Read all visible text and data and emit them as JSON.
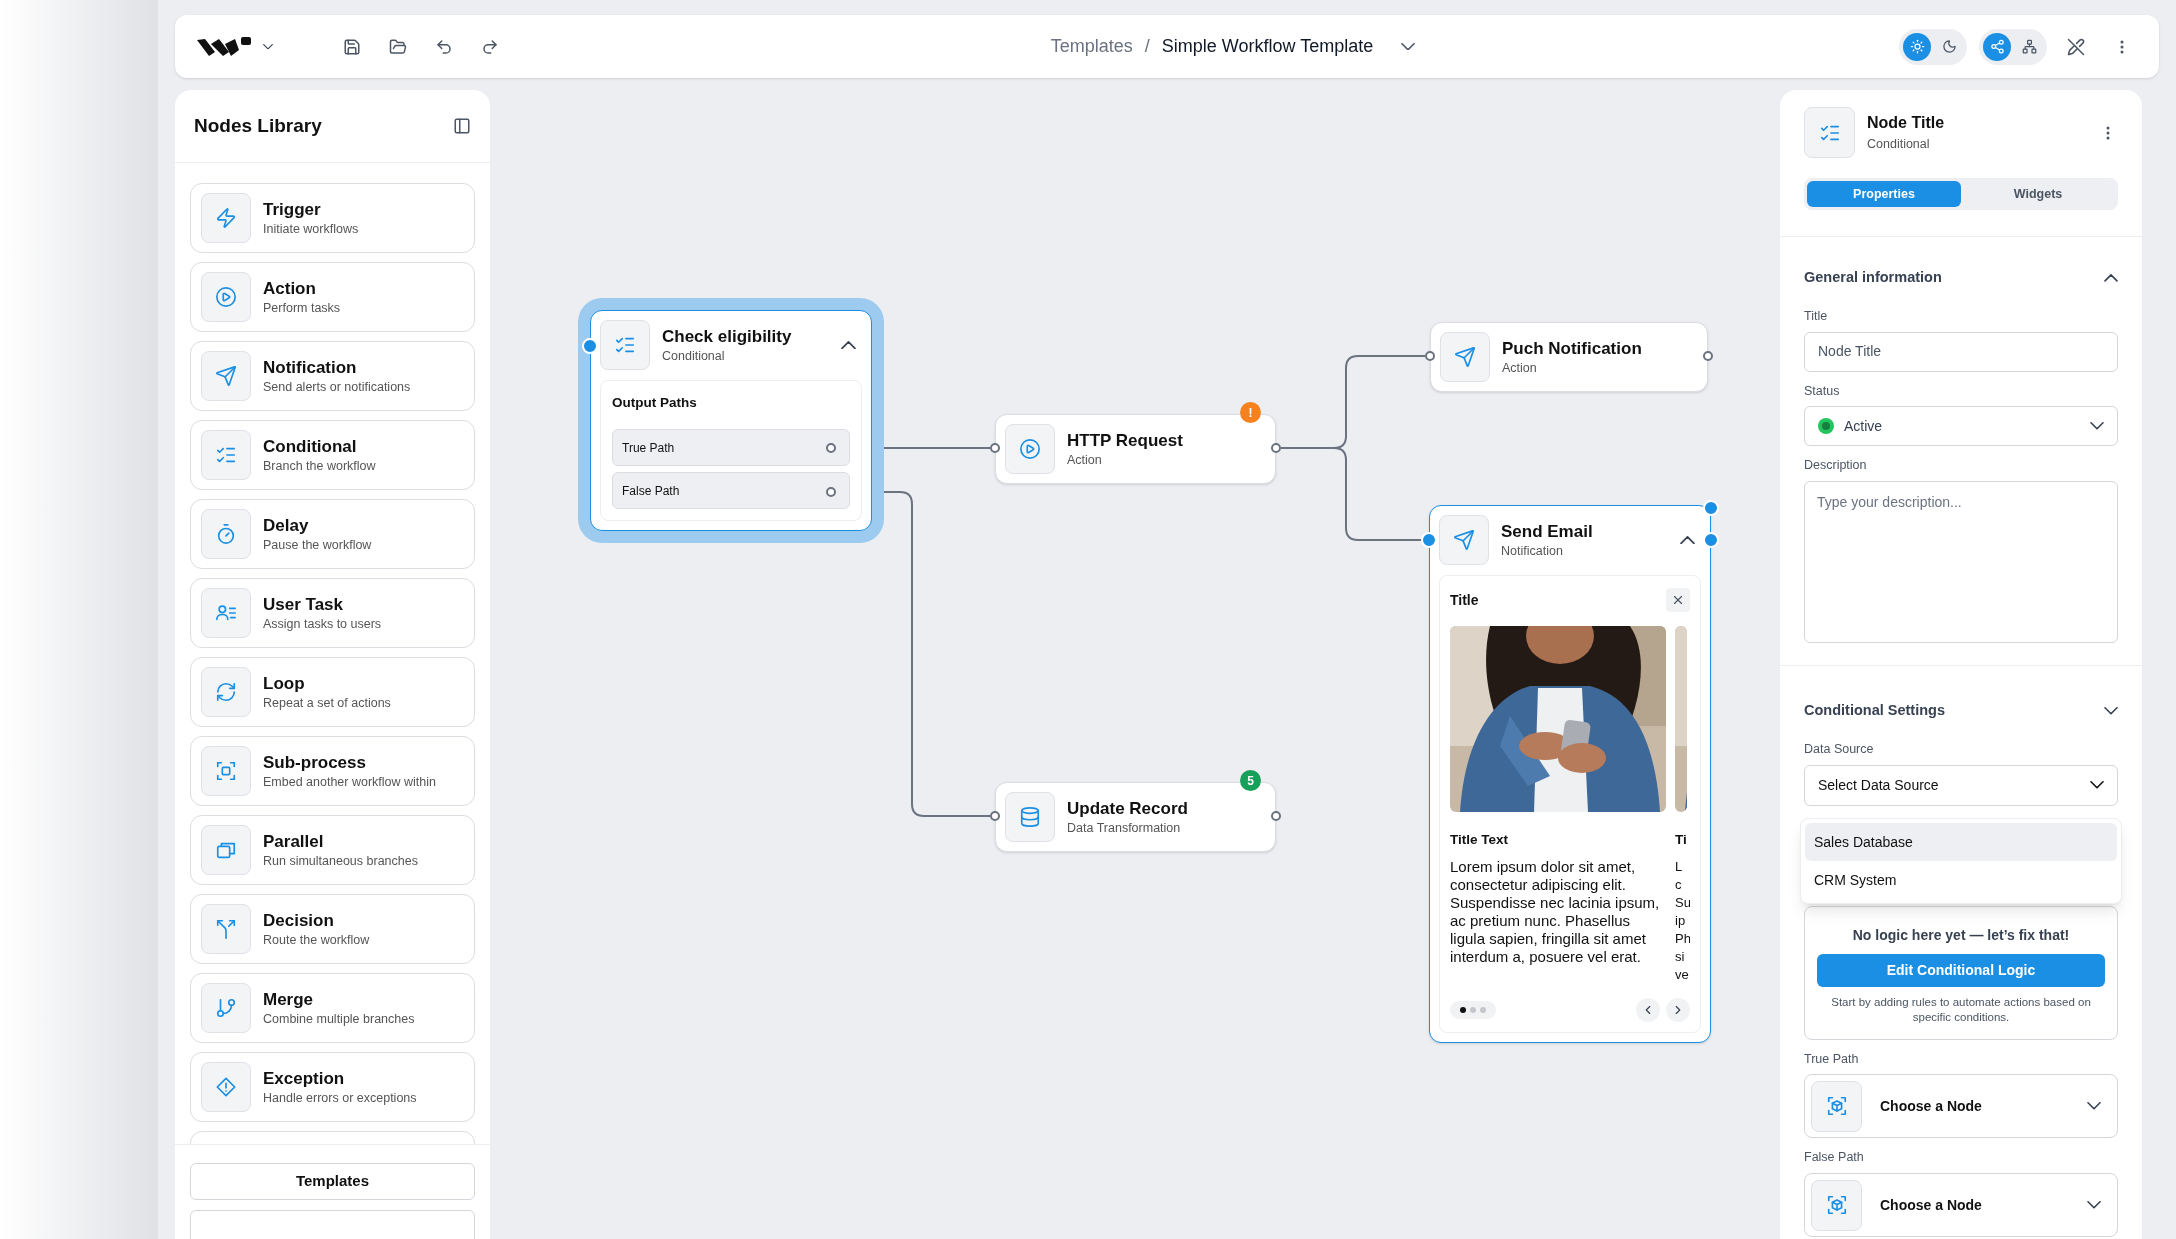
{
  "breadcrumb": {
    "items": [
      "Templates",
      "Simple Workflow Template"
    ],
    "separator": "/"
  },
  "theme_toggle": [
    {
      "kind": "light",
      "selected": true
    },
    {
      "kind": "dark",
      "selected": false
    }
  ],
  "view_toggle": [
    {
      "kind": "flow",
      "selected": true
    },
    {
      "kind": "tree",
      "selected": false
    }
  ],
  "nodes_library": {
    "title": "Nodes Library",
    "items": [
      {
        "kind": "trigger",
        "name": "Trigger",
        "description": "Initiate workflows"
      },
      {
        "kind": "action",
        "name": "Action",
        "description": "Perform tasks"
      },
      {
        "kind": "notification",
        "name": "Notification",
        "description": "Send alerts or notifications"
      },
      {
        "kind": "conditional",
        "name": "Conditional",
        "description": "Branch the workflow"
      },
      {
        "kind": "delay",
        "name": "Delay",
        "description": "Pause the workflow"
      },
      {
        "kind": "user_task",
        "name": "User Task",
        "description": "Assign tasks to users"
      },
      {
        "kind": "loop",
        "name": "Loop",
        "description": "Repeat a set of actions"
      },
      {
        "kind": "subprocess",
        "name": "Sub-process",
        "description": "Embed another workflow within"
      },
      {
        "kind": "parallel",
        "name": "Parallel",
        "description": "Run simultaneous branches"
      },
      {
        "kind": "decision",
        "name": "Decision",
        "description": "Route the workflow"
      },
      {
        "kind": "merge",
        "name": "Merge",
        "description": "Combine multiple branches"
      },
      {
        "kind": "exception",
        "name": "Exception",
        "description": "Handle errors or exceptions"
      }
    ],
    "buttons": [
      "Templates"
    ]
  },
  "canvas_nodes": [
    {
      "kind": "conditional",
      "title": "Check eligibility",
      "subtitle": "Conditional",
      "selected": true,
      "highlighted": true,
      "expanded": true,
      "section_title": "Output Paths",
      "paths": [
        "True Path",
        "False Path"
      ]
    },
    {
      "kind": "action",
      "title": "HTTP Request",
      "subtitle": "Action",
      "selected": false,
      "highlighted": false,
      "badge": {
        "text": "!",
        "color": "#f5821f"
      }
    },
    {
      "kind": "record",
      "title": "Update Record",
      "subtitle": "Data Transformation",
      "selected": false,
      "highlighted": false,
      "badge": {
        "text": "5",
        "color": "#16a05a"
      }
    },
    {
      "kind": "notification",
      "title": "Puch Notification",
      "subtitle": "Action",
      "selected": false,
      "highlighted": false
    },
    {
      "kind": "email",
      "title": "Send Email",
      "subtitle": "Notification",
      "selected": true,
      "highlighted": false,
      "expanded": true,
      "card": {
        "title": "Title",
        "slides": [
          {
            "title": "Title Text",
            "body": "Lorem ipsum dolor sit amet, consectetur adipiscing elit. Suspendisse nec lacinia ipsum, ac pretium nunc. Phasellus ligula sapien, fringilla sit amet interdum a, posuere vel erat."
          },
          {
            "title": "Ti",
            "lines": [
              "L",
              "c",
              "Su",
              "ip",
              "Ph",
              "si",
              "ve"
            ]
          }
        ],
        "dots": [
          {
            "selected": true
          },
          {
            "selected": false
          },
          {
            "selected": false
          }
        ]
      }
    }
  ],
  "inspector": {
    "title": "Node Title",
    "subtitle": "Conditional",
    "tabs": [
      {
        "label": "Properties",
        "selected": true
      },
      {
        "label": "Widgets",
        "selected": false
      }
    ],
    "general": {
      "heading": "General information",
      "title_label": "Title",
      "title_value": "Node Title",
      "status_label": "Status",
      "status_value": "Active",
      "description_label": "Description",
      "description_placeholder": "Type your description..."
    },
    "conditional": {
      "heading": "Conditional Settings",
      "data_source_label": "Data Source",
      "data_source_placeholder": "Select Data Source",
      "dropdown_open": true,
      "options": [
        {
          "label": "Sales Database",
          "selected": true
        },
        {
          "label": "CRM System",
          "selected": false
        }
      ],
      "logic_message": "No logic here yet — let’s fix that!",
      "logic_button": "Edit Conditional Logic",
      "logic_hint": "Start by adding rules to automate actions based on specific conditions.",
      "paths": [
        {
          "label": "True Path",
          "placeholder": "Choose a Node"
        },
        {
          "label": "False Path",
          "placeholder": "Choose a Node"
        }
      ]
    }
  }
}
